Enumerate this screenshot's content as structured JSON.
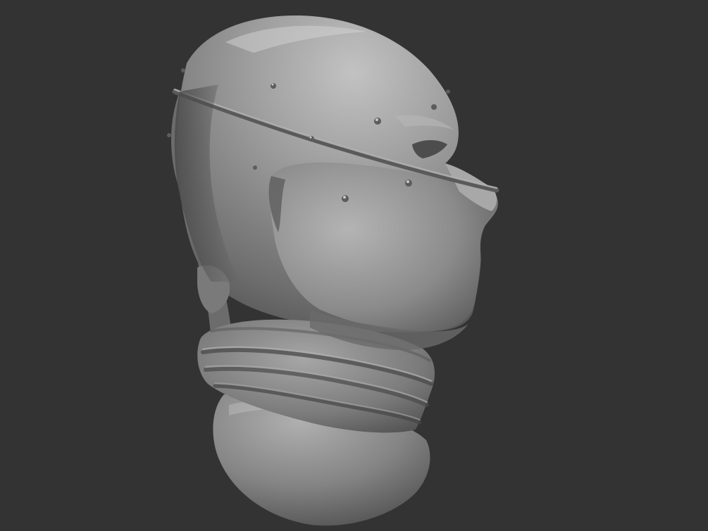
{
  "viewport": {
    "background_color": "#333333"
  },
  "model": {
    "material_base_color": "#8a8a8a",
    "material_highlight_color": "#c4c4c4",
    "material_shadow_color": "#3e3e3e"
  }
}
